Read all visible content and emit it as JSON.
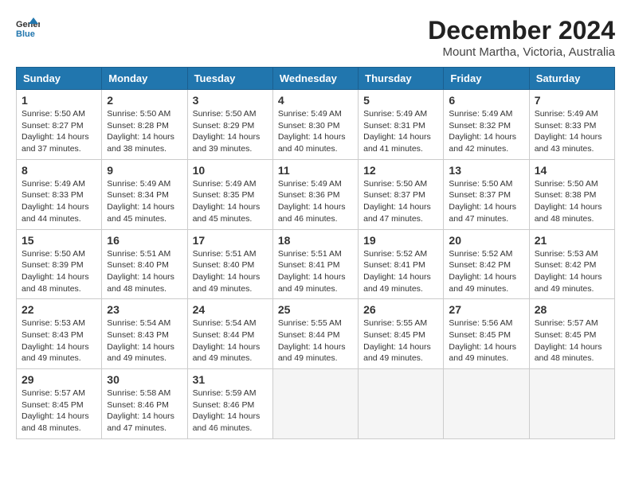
{
  "logo": {
    "line1": "General",
    "line2": "Blue"
  },
  "title": "December 2024",
  "location": "Mount Martha, Victoria, Australia",
  "headers": [
    "Sunday",
    "Monday",
    "Tuesday",
    "Wednesday",
    "Thursday",
    "Friday",
    "Saturday"
  ],
  "weeks": [
    [
      {
        "day": "1",
        "text": "Sunrise: 5:50 AM\nSunset: 8:27 PM\nDaylight: 14 hours\nand 37 minutes."
      },
      {
        "day": "2",
        "text": "Sunrise: 5:50 AM\nSunset: 8:28 PM\nDaylight: 14 hours\nand 38 minutes."
      },
      {
        "day": "3",
        "text": "Sunrise: 5:50 AM\nSunset: 8:29 PM\nDaylight: 14 hours\nand 39 minutes."
      },
      {
        "day": "4",
        "text": "Sunrise: 5:49 AM\nSunset: 8:30 PM\nDaylight: 14 hours\nand 40 minutes."
      },
      {
        "day": "5",
        "text": "Sunrise: 5:49 AM\nSunset: 8:31 PM\nDaylight: 14 hours\nand 41 minutes."
      },
      {
        "day": "6",
        "text": "Sunrise: 5:49 AM\nSunset: 8:32 PM\nDaylight: 14 hours\nand 42 minutes."
      },
      {
        "day": "7",
        "text": "Sunrise: 5:49 AM\nSunset: 8:33 PM\nDaylight: 14 hours\nand 43 minutes."
      }
    ],
    [
      {
        "day": "8",
        "text": "Sunrise: 5:49 AM\nSunset: 8:33 PM\nDaylight: 14 hours\nand 44 minutes."
      },
      {
        "day": "9",
        "text": "Sunrise: 5:49 AM\nSunset: 8:34 PM\nDaylight: 14 hours\nand 45 minutes."
      },
      {
        "day": "10",
        "text": "Sunrise: 5:49 AM\nSunset: 8:35 PM\nDaylight: 14 hours\nand 45 minutes."
      },
      {
        "day": "11",
        "text": "Sunrise: 5:49 AM\nSunset: 8:36 PM\nDaylight: 14 hours\nand 46 minutes."
      },
      {
        "day": "12",
        "text": "Sunrise: 5:50 AM\nSunset: 8:37 PM\nDaylight: 14 hours\nand 47 minutes."
      },
      {
        "day": "13",
        "text": "Sunrise: 5:50 AM\nSunset: 8:37 PM\nDaylight: 14 hours\nand 47 minutes."
      },
      {
        "day": "14",
        "text": "Sunrise: 5:50 AM\nSunset: 8:38 PM\nDaylight: 14 hours\nand 48 minutes."
      }
    ],
    [
      {
        "day": "15",
        "text": "Sunrise: 5:50 AM\nSunset: 8:39 PM\nDaylight: 14 hours\nand 48 minutes."
      },
      {
        "day": "16",
        "text": "Sunrise: 5:51 AM\nSunset: 8:40 PM\nDaylight: 14 hours\nand 48 minutes."
      },
      {
        "day": "17",
        "text": "Sunrise: 5:51 AM\nSunset: 8:40 PM\nDaylight: 14 hours\nand 49 minutes."
      },
      {
        "day": "18",
        "text": "Sunrise: 5:51 AM\nSunset: 8:41 PM\nDaylight: 14 hours\nand 49 minutes."
      },
      {
        "day": "19",
        "text": "Sunrise: 5:52 AM\nSunset: 8:41 PM\nDaylight: 14 hours\nand 49 minutes."
      },
      {
        "day": "20",
        "text": "Sunrise: 5:52 AM\nSunset: 8:42 PM\nDaylight: 14 hours\nand 49 minutes."
      },
      {
        "day": "21",
        "text": "Sunrise: 5:53 AM\nSunset: 8:42 PM\nDaylight: 14 hours\nand 49 minutes."
      }
    ],
    [
      {
        "day": "22",
        "text": "Sunrise: 5:53 AM\nSunset: 8:43 PM\nDaylight: 14 hours\nand 49 minutes."
      },
      {
        "day": "23",
        "text": "Sunrise: 5:54 AM\nSunset: 8:43 PM\nDaylight: 14 hours\nand 49 minutes."
      },
      {
        "day": "24",
        "text": "Sunrise: 5:54 AM\nSunset: 8:44 PM\nDaylight: 14 hours\nand 49 minutes."
      },
      {
        "day": "25",
        "text": "Sunrise: 5:55 AM\nSunset: 8:44 PM\nDaylight: 14 hours\nand 49 minutes."
      },
      {
        "day": "26",
        "text": "Sunrise: 5:55 AM\nSunset: 8:45 PM\nDaylight: 14 hours\nand 49 minutes."
      },
      {
        "day": "27",
        "text": "Sunrise: 5:56 AM\nSunset: 8:45 PM\nDaylight: 14 hours\nand 49 minutes."
      },
      {
        "day": "28",
        "text": "Sunrise: 5:57 AM\nSunset: 8:45 PM\nDaylight: 14 hours\nand 48 minutes."
      }
    ],
    [
      {
        "day": "29",
        "text": "Sunrise: 5:57 AM\nSunset: 8:45 PM\nDaylight: 14 hours\nand 48 minutes."
      },
      {
        "day": "30",
        "text": "Sunrise: 5:58 AM\nSunset: 8:46 PM\nDaylight: 14 hours\nand 47 minutes."
      },
      {
        "day": "31",
        "text": "Sunrise: 5:59 AM\nSunset: 8:46 PM\nDaylight: 14 hours\nand 46 minutes."
      },
      null,
      null,
      null,
      null
    ]
  ]
}
